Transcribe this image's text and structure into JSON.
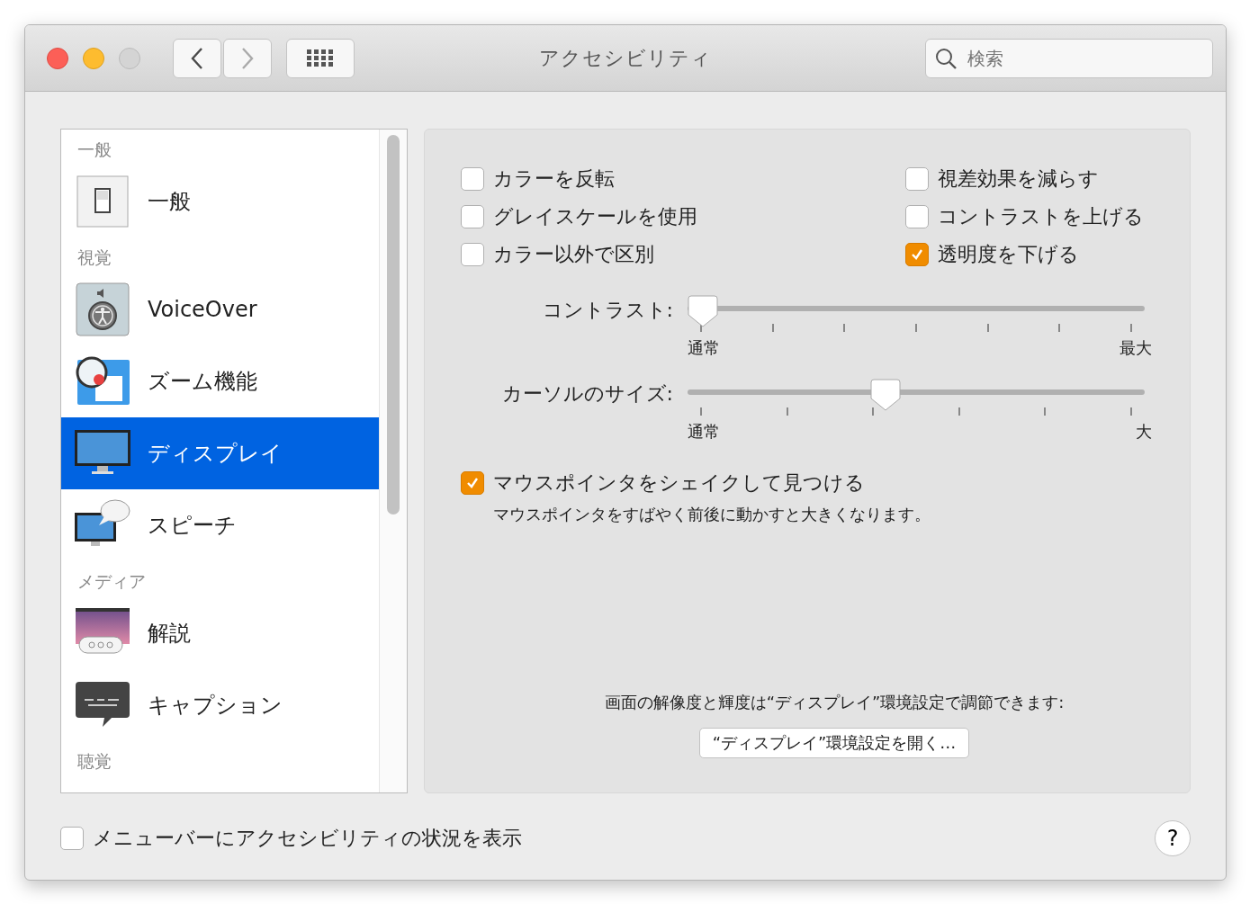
{
  "window": {
    "title": "アクセシビリティ",
    "search_placeholder": "検索"
  },
  "sidebar": {
    "items": [
      {
        "kind": "header",
        "label": "一般"
      },
      {
        "kind": "item",
        "label": "一般",
        "selected": false
      },
      {
        "kind": "header",
        "label": "視覚"
      },
      {
        "kind": "item",
        "label": "VoiceOver",
        "selected": false
      },
      {
        "kind": "item",
        "label": "ズーム機能",
        "selected": false
      },
      {
        "kind": "item",
        "label": "ディスプレイ",
        "selected": true
      },
      {
        "kind": "item",
        "label": "スピーチ",
        "selected": false
      },
      {
        "kind": "header",
        "label": "メディア"
      },
      {
        "kind": "item",
        "label": "解説",
        "selected": false
      },
      {
        "kind": "item",
        "label": "キャプション",
        "selected": false
      },
      {
        "kind": "header",
        "label": "聴覚"
      }
    ]
  },
  "options": [
    {
      "label": "カラーを反転",
      "checked": false
    },
    {
      "label": "視差効果を減らす",
      "checked": false
    },
    {
      "label": "グレイスケールを使用",
      "checked": false
    },
    {
      "label": "コントラストを上げる",
      "checked": false
    },
    {
      "label": "カラー以外で区別",
      "checked": false
    },
    {
      "label": "透明度を下げる",
      "checked": true
    }
  ],
  "sliders": [
    {
      "label": "コントラスト:",
      "level": 0,
      "min_label": "通常",
      "max_label": "最大"
    },
    {
      "label": "カーソルのサイズ:",
      "level": 0.4,
      "min_label": "通常",
      "max_label": "大"
    }
  ],
  "shake": {
    "label": "マウスポインタをシェイクして見つける",
    "checked": true,
    "description": "マウスポインタをすばやく前後に動かすと大きくなります。"
  },
  "display_note": "画面の解像度と輝度は“ディスプレイ”環境設定で調節できます:",
  "display_button": "“ディスプレイ”環境設定を開く…",
  "menubar_option": {
    "label": "メニューバーにアクセシビリティの状況を表示",
    "checked": false
  },
  "help_button": "?"
}
